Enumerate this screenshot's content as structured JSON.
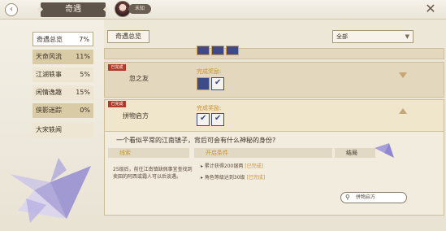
{
  "header": {
    "title": "奇遇",
    "user_tag": "未知"
  },
  "sidebar": {
    "items": [
      {
        "label": "奇遇总览",
        "value": "7%"
      },
      {
        "label": "天命风流",
        "value": "11%"
      },
      {
        "label": "江湖轶事",
        "value": "5%"
      },
      {
        "label": "闲情逸趣",
        "value": "15%"
      },
      {
        "label": "侠影迷踪",
        "value": "0%"
      },
      {
        "label": "大宋轶闻",
        "value": ""
      }
    ],
    "done_badge": "已完成"
  },
  "main": {
    "tab_overview": "奇遇总览",
    "filter_value": "全部",
    "cards": [
      {
        "badge": "已完成",
        "name": "忽之友",
        "reward_label": "完成奖励:"
      },
      {
        "badge": "已完成",
        "name": "拼物启方",
        "reward_label": "完成奖励:"
      }
    ],
    "detail": {
      "question": "一个看似平常的江南镇子，背后可会有什么神秘的身份?",
      "clue_head": "线索",
      "clue_text": "25级后，前往江南镇缺佩事宜查找到卖田的阿西或霜人可以后谈遇。",
      "cond_head": "开启条件",
      "cond_1": "▸ 累计获得200银两",
      "cond_1_status": "[已完成]",
      "cond_2": "▸ 角色等级达到30级",
      "cond_2_status": "[已完成]",
      "result_head": "结局",
      "result_btn": "拼物启方"
    }
  }
}
